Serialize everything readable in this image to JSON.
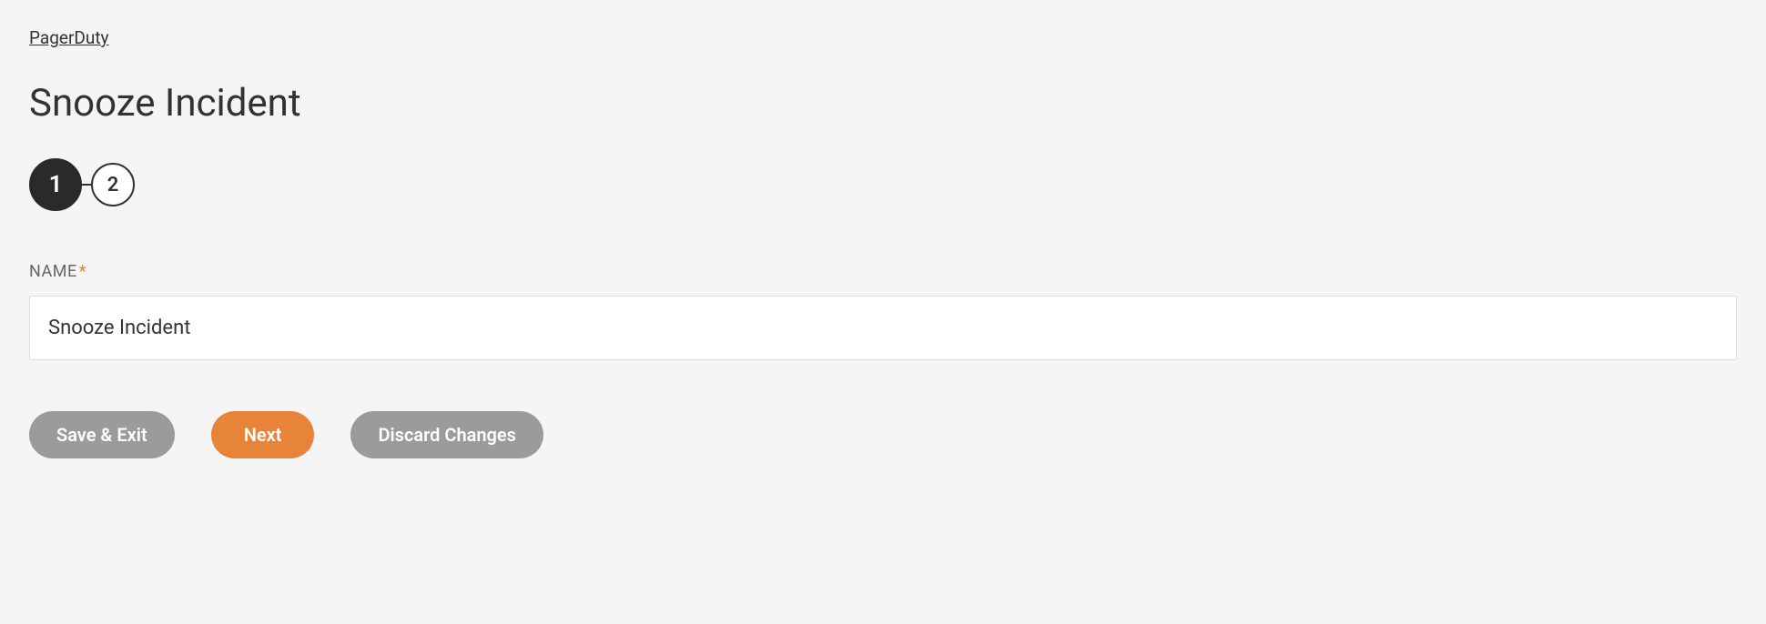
{
  "breadcrumb": {
    "label": "PagerDuty"
  },
  "page": {
    "title": "Snooze Incident"
  },
  "stepper": {
    "steps": [
      {
        "label": "1",
        "active": true
      },
      {
        "label": "2",
        "active": false
      }
    ]
  },
  "form": {
    "name": {
      "label": "NAME",
      "required_mark": "*",
      "value": "Snooze Incident"
    }
  },
  "buttons": {
    "save_exit": "Save & Exit",
    "next": "Next",
    "discard": "Discard Changes"
  }
}
